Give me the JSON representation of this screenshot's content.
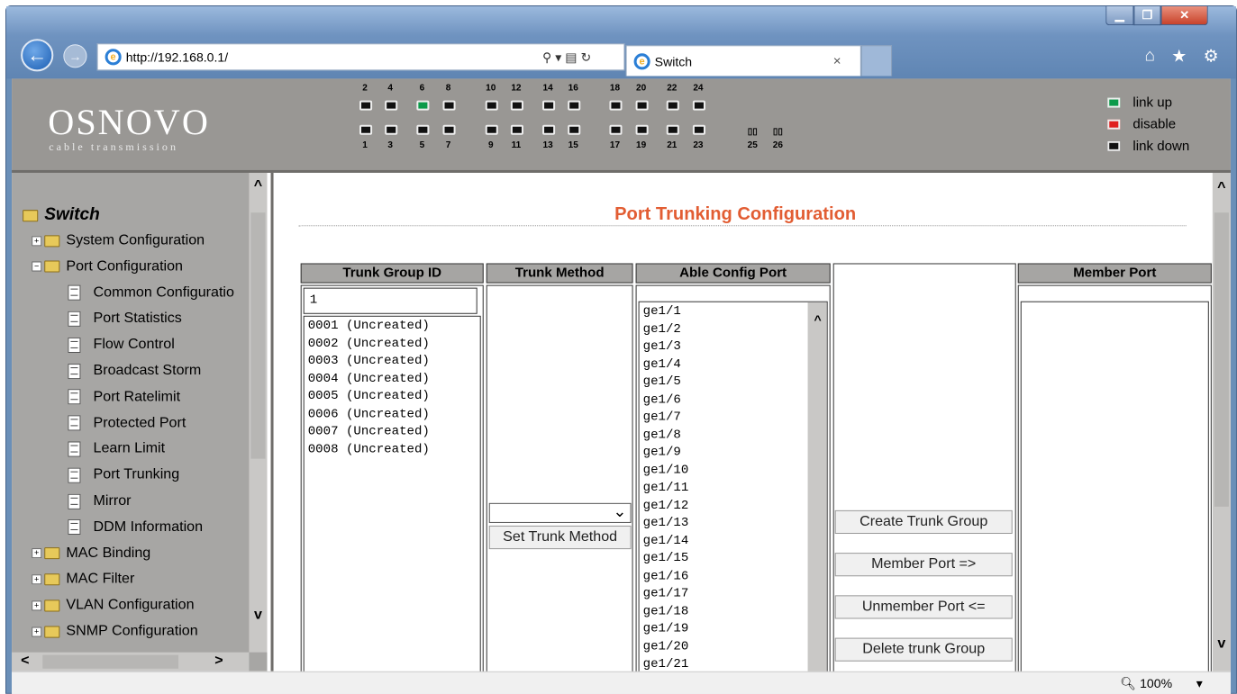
{
  "browser": {
    "url": "http://192.168.0.1/",
    "tab_title": "Switch",
    "tab_close": "×",
    "address_tools": "⚲ ▾ ▤ ↻",
    "window_controls": {
      "minimize": "▁",
      "maximize": "❐",
      "close": "✕"
    },
    "toolbar_icons": {
      "home": "⌂",
      "favorites": "★",
      "settings": "⚙"
    },
    "zoom": "100%",
    "zoom_arrow": "▾"
  },
  "banner": {
    "logo": "OSNOVO",
    "logo_sub": "cable transmission",
    "top_ports": [
      "2",
      "4",
      "6",
      "8",
      "10",
      "12",
      "14",
      "16",
      "18",
      "20",
      "22",
      "24"
    ],
    "bottom_ports": [
      "1",
      "3",
      "5",
      "7",
      "9",
      "11",
      "13",
      "15",
      "17",
      "19",
      "21",
      "23",
      "25",
      "26"
    ],
    "sfp_glyph": "▯▯",
    "legend": [
      {
        "label": "link up",
        "color": "#0b9a4a"
      },
      {
        "label": "disable",
        "color": "#e02020"
      },
      {
        "label": "link down",
        "color": "#111111"
      }
    ],
    "link_up_ports": [
      "6"
    ]
  },
  "sidebar": {
    "root": "Switch",
    "items": [
      {
        "label": "System Configuration",
        "type": "folder",
        "expanded": false
      },
      {
        "label": "Port Configuration",
        "type": "folder",
        "expanded": true
      },
      {
        "label": "Common Configuratio",
        "type": "page"
      },
      {
        "label": "Port Statistics",
        "type": "page"
      },
      {
        "label": "Flow Control",
        "type": "page"
      },
      {
        "label": "Broadcast Storm",
        "type": "page"
      },
      {
        "label": "Port Ratelimit",
        "type": "page"
      },
      {
        "label": "Protected Port",
        "type": "page"
      },
      {
        "label": "Learn Limit",
        "type": "page"
      },
      {
        "label": "Port Trunking",
        "type": "page"
      },
      {
        "label": "Mirror",
        "type": "page"
      },
      {
        "label": "DDM Information",
        "type": "page"
      },
      {
        "label": "MAC Binding",
        "type": "folder",
        "expanded": false
      },
      {
        "label": "MAC Filter",
        "type": "folder",
        "expanded": false
      },
      {
        "label": "VLAN Configuration",
        "type": "folder",
        "expanded": false
      },
      {
        "label": "SNMP Configuration",
        "type": "folder",
        "expanded": false
      }
    ],
    "plus": "+",
    "minus": "−"
  },
  "scroll": {
    "up": "^",
    "down": "v",
    "left": "<",
    "right": ">"
  },
  "page": {
    "title": "Port Trunking Configuration",
    "headers": {
      "trunk_group_id": "Trunk Group ID",
      "trunk_method": "Trunk Method",
      "able_config_port": "Able Config Port",
      "member_port": "Member Port"
    },
    "trunk_id_value": "1",
    "trunk_groups": [
      "0001 (Uncreated)",
      "0002 (Uncreated)",
      "0003 (Uncreated)",
      "0004 (Uncreated)",
      "0005 (Uncreated)",
      "0006 (Uncreated)",
      "0007 (Uncreated)",
      "0008 (Uncreated)"
    ],
    "trunk_method_selected": "",
    "set_trunk_method": "Set Trunk Method",
    "select_arrow": "⌄",
    "able_ports": [
      "ge1/1",
      "ge1/2",
      "ge1/3",
      "ge1/4",
      "ge1/5",
      "ge1/6",
      "ge1/7",
      "ge1/8",
      "ge1/9",
      "ge1/10",
      "ge1/11",
      "ge1/12",
      "ge1/13",
      "ge1/14",
      "ge1/15",
      "ge1/16",
      "ge1/17",
      "ge1/18",
      "ge1/19",
      "ge1/20",
      "ge1/21"
    ],
    "buttons": {
      "create": "Create Trunk Group",
      "member": "Member Port =>",
      "unmember": "Unmember Port <=",
      "delete": "Delete trunk Group"
    }
  }
}
